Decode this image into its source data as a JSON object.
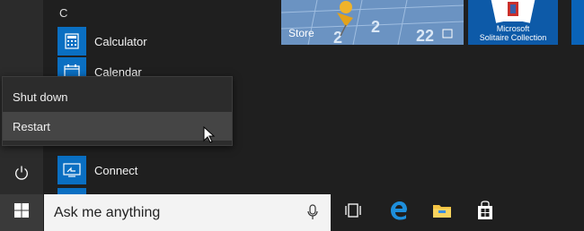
{
  "app_list": {
    "letter": "C",
    "items": [
      {
        "label": "Calculator",
        "icon": "calculator-icon"
      },
      {
        "label": "Calendar",
        "icon": "calendar-icon"
      },
      {
        "label": "Connect",
        "icon": "connect-icon"
      }
    ]
  },
  "power_menu": {
    "shutdown_label": "Shut down",
    "restart_label": "Restart"
  },
  "tiles": {
    "store_label": "Store",
    "solitaire_label_line1": "Microsoft",
    "solitaire_label_line2": "Solitaire Collection"
  },
  "taskbar": {
    "search_placeholder": "Ask me anything",
    "icons": [
      "windows-logo-icon",
      "microphone-icon",
      "task-view-icon",
      "edge-icon",
      "file-explorer-icon",
      "store-icon"
    ]
  },
  "colors": {
    "accent": "#0a6fc2",
    "menu_bg": "#1f1f1f",
    "highlight": "#454545",
    "edge_blue": "#1e8fdc",
    "folder_yellow": "#f5c342"
  }
}
